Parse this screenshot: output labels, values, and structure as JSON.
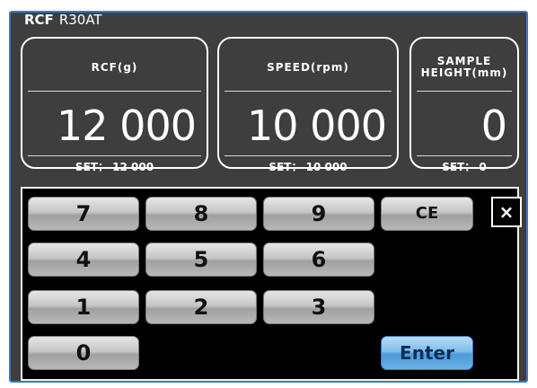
{
  "header": {
    "title_bold": "RCF",
    "title_model": "R30AT"
  },
  "panels": {
    "rcf": {
      "label": "RCF(g)",
      "value": "12 000",
      "set_label": "SET：",
      "set_value": "12 000"
    },
    "speed": {
      "label": "SPEED(rpm)",
      "value": "10 000",
      "set_label": "SET：",
      "set_value": "10 000"
    },
    "height": {
      "label_line1": "SAMPLE",
      "label_line2": "HEIGHT(mm)",
      "value": "0",
      "set_label": "SET：",
      "set_value": "0"
    }
  },
  "keypad": {
    "keys": [
      "7",
      "8",
      "9",
      "4",
      "5",
      "6",
      "1",
      "2",
      "3",
      "0"
    ],
    "ce": "CE",
    "enter": "Enter",
    "close": "×"
  },
  "colors": {
    "panel_bg": "#3e3e3e",
    "frame_blue": "#3b78c8",
    "enter_blue": "#6db2e6",
    "keypad_bg": "#000000"
  }
}
